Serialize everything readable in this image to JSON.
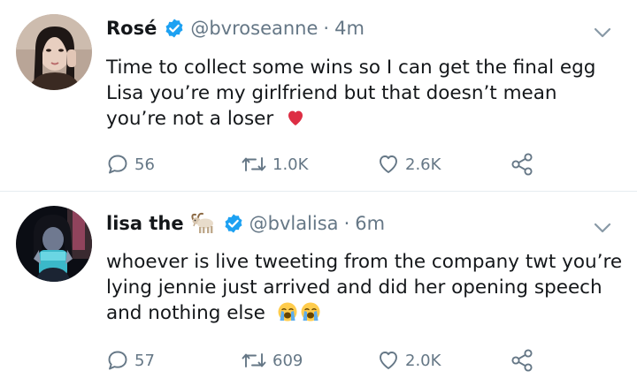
{
  "tweets": [
    {
      "name": "Rosé",
      "handle": "@bvroseanne",
      "time": "4m",
      "lines": [
        "Time to collect some wins so I can get the final egg",
        "Lisa you’re my girlfriend but that doesn’t mean",
        "you’re not a loser"
      ],
      "emoji": [
        "red-heart-emoji"
      ],
      "replies": "56",
      "retweets": "1.0K",
      "likes": "2.6K"
    },
    {
      "name": "lisa the",
      "name_emoji": "goat-emoji",
      "handle": "@bvlalisa",
      "time": "6m",
      "lines": [
        "whoever is live tweeting from the company twt you’re",
        "lying jennie just arrived and did her opening speech",
        "and nothing else"
      ],
      "emoji": [
        "loudly-crying-face-emoji",
        "loudly-crying-face-emoji"
      ],
      "replies": "57",
      "retweets": "609",
      "likes": "2.0K"
    }
  ],
  "separator": "·",
  "colors": {
    "verified": "#1da1f2",
    "secondary_text": "#657786",
    "text": "#14171a",
    "divider": "#e6ecf0"
  }
}
